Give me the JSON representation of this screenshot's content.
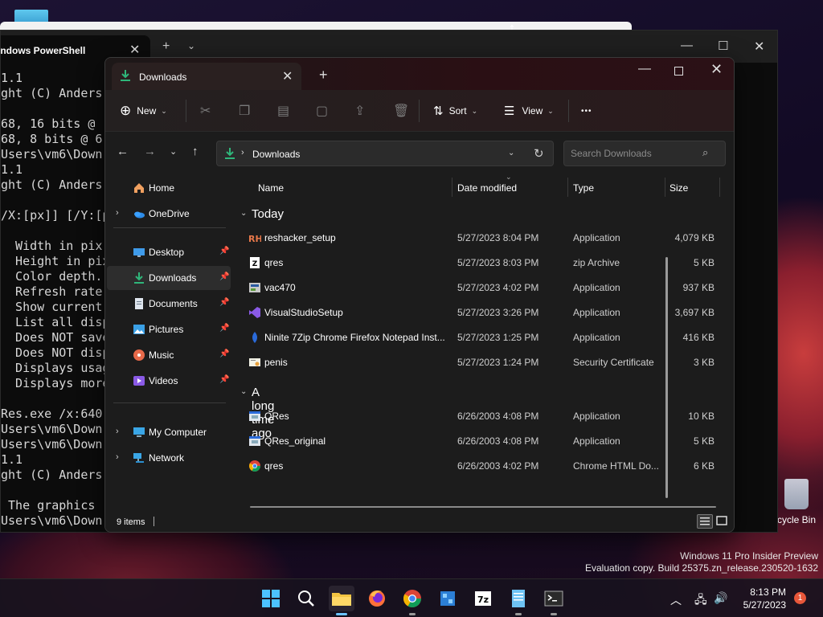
{
  "desktop": {
    "recycle_bin_label": "cycle Bin",
    "watermark_line1": "Windows 11 Pro Insider Preview",
    "watermark_line2": "Evaluation copy. Build 25375.zn_release.230520-1632"
  },
  "powershell": {
    "tab_title": "indows PowerShell",
    "close_glyph": "✕",
    "newtab_glyph": "+",
    "dropdown_glyph": "⌄",
    "console_lines": [
      "1.1",
      "ght (C) Anders",
      "",
      "68, 16 bits @",
      "68, 8 bits @ 6",
      "Users\\vm6\\Down",
      "1.1",
      "ght (C) Anders",
      "",
      "/X:[px]] [/Y:[p",
      "",
      "  Width in pix",
      "  Height in pix",
      "  Color depth.",
      "  Refresh rate",
      "  Show current",
      "  List all disp",
      "  Does NOT save",
      "  Does NOT disp",
      "  Displays usag",
      "  Displays more",
      "",
      "Res.exe /x:640",
      "Users\\vm6\\Down",
      "Users\\vm6\\Down",
      "1.1",
      "ght (C) Anders",
      "",
      " The graphics",
      "Users\\vm6\\Down"
    ]
  },
  "explorer": {
    "tab_title": "Downloads",
    "toolbar": {
      "new_label": "New",
      "sort_label": "Sort",
      "view_label": "View",
      "more_label": "•••"
    },
    "address": {
      "crumb": "Downloads",
      "search_placeholder": "Search Downloads"
    },
    "sidebar": [
      {
        "label": "Home",
        "icon": "home-icon",
        "pinned": false,
        "expandable": false
      },
      {
        "label": "OneDrive",
        "icon": "onedrive-icon",
        "pinned": false,
        "expandable": true
      },
      {
        "label": "Desktop",
        "icon": "desktop-icon",
        "pinned": true,
        "expandable": false
      },
      {
        "label": "Downloads",
        "icon": "downloads-icon",
        "pinned": true,
        "expandable": false,
        "selected": true
      },
      {
        "label": "Documents",
        "icon": "documents-icon",
        "pinned": true,
        "expandable": false
      },
      {
        "label": "Pictures",
        "icon": "pictures-icon",
        "pinned": true,
        "expandable": false
      },
      {
        "label": "Music",
        "icon": "music-icon",
        "pinned": true,
        "expandable": false
      },
      {
        "label": "Videos",
        "icon": "videos-icon",
        "pinned": true,
        "expandable": false
      },
      {
        "label": "My Computer",
        "icon": "computer-icon",
        "pinned": false,
        "expandable": true
      },
      {
        "label": "Network",
        "icon": "network-icon",
        "pinned": false,
        "expandable": true
      }
    ],
    "columns": {
      "name": "Name",
      "date": "Date modified",
      "type": "Type",
      "size": "Size"
    },
    "groups": [
      {
        "label": "Today",
        "files": [
          {
            "name": "reshacker_setup",
            "date": "5/27/2023 8:04 PM",
            "type": "Application",
            "size": "4,079 KB",
            "icon": "reshacker-icon"
          },
          {
            "name": "qres",
            "date": "5/27/2023 8:03 PM",
            "type": "zip Archive",
            "size": "5 KB",
            "icon": "zip-icon"
          },
          {
            "name": "vac470",
            "date": "5/27/2023 4:02 PM",
            "type": "Application",
            "size": "937 KB",
            "icon": "installer-icon"
          },
          {
            "name": "VisualStudioSetup",
            "date": "5/27/2023 3:26 PM",
            "type": "Application",
            "size": "3,697 KB",
            "icon": "visual-studio-icon"
          },
          {
            "name": "Ninite 7Zip Chrome Firefox Notepad Inst...",
            "date": "5/27/2023 1:25 PM",
            "type": "Application",
            "size": "416 KB",
            "icon": "ninite-icon"
          },
          {
            "name": "penis",
            "date": "5/27/2023 1:24 PM",
            "type": "Security Certificate",
            "size": "3 KB",
            "icon": "certificate-icon"
          }
        ]
      },
      {
        "label": "A long time ago",
        "files": [
          {
            "name": "QRes",
            "date": "6/26/2003 4:08 PM",
            "type": "Application",
            "size": "10 KB",
            "icon": "exe-icon"
          },
          {
            "name": "QRes_original",
            "date": "6/26/2003 4:08 PM",
            "type": "Application",
            "size": "5 KB",
            "icon": "exe-icon"
          },
          {
            "name": "qres",
            "date": "6/26/2003 4:02 PM",
            "type": "Chrome HTML Do...",
            "size": "6 KB",
            "icon": "chrome-icon"
          }
        ]
      }
    ],
    "status_count": "9 items"
  },
  "taskbar": {
    "apps": [
      "start",
      "search",
      "file-explorer",
      "firefox",
      "chrome",
      "resource-hacker",
      "7zip",
      "notepad",
      "terminal"
    ],
    "time": "8:13 PM",
    "date": "5/27/2023",
    "notification_count": "1"
  },
  "colors": {
    "accent": "#6cc3ff",
    "download_green": "#2fb67a",
    "folder_yellow": "#f4c542",
    "notification_orange": "#e8573a"
  }
}
